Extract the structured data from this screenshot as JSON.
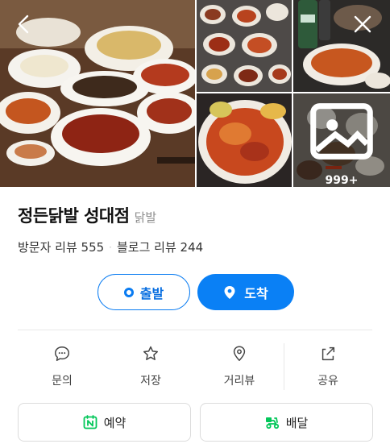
{
  "gallery": {
    "more_count": "999+",
    "photos": [
      {
        "icon": "food-photo-main"
      },
      {
        "icon": "food-photo-table"
      },
      {
        "icon": "food-photo-drinks"
      },
      {
        "icon": "food-photo-chicken-feet"
      },
      {
        "icon": "food-photo-more"
      }
    ]
  },
  "place": {
    "name": "정든닭발 성대점",
    "category": "닭발"
  },
  "reviews": {
    "visitor_label": "방문자 리뷰 555",
    "blog_label": "블로그 리뷰 244",
    "separator": "·"
  },
  "route": {
    "depart_label": "출발",
    "arrive_label": "도착"
  },
  "actions": [
    {
      "label": "문의",
      "icon": "chat-bubble-icon"
    },
    {
      "label": "저장",
      "icon": "star-icon"
    },
    {
      "label": "거리뷰",
      "icon": "map-pin-icon"
    },
    {
      "label": "공유",
      "icon": "share-icon"
    }
  ],
  "services": {
    "reserve_label": "예약",
    "delivery_label": "배달"
  },
  "colors": {
    "accent": "#0a80f5",
    "naver_green": "#03c75a",
    "muted": "#8d8d8d"
  }
}
